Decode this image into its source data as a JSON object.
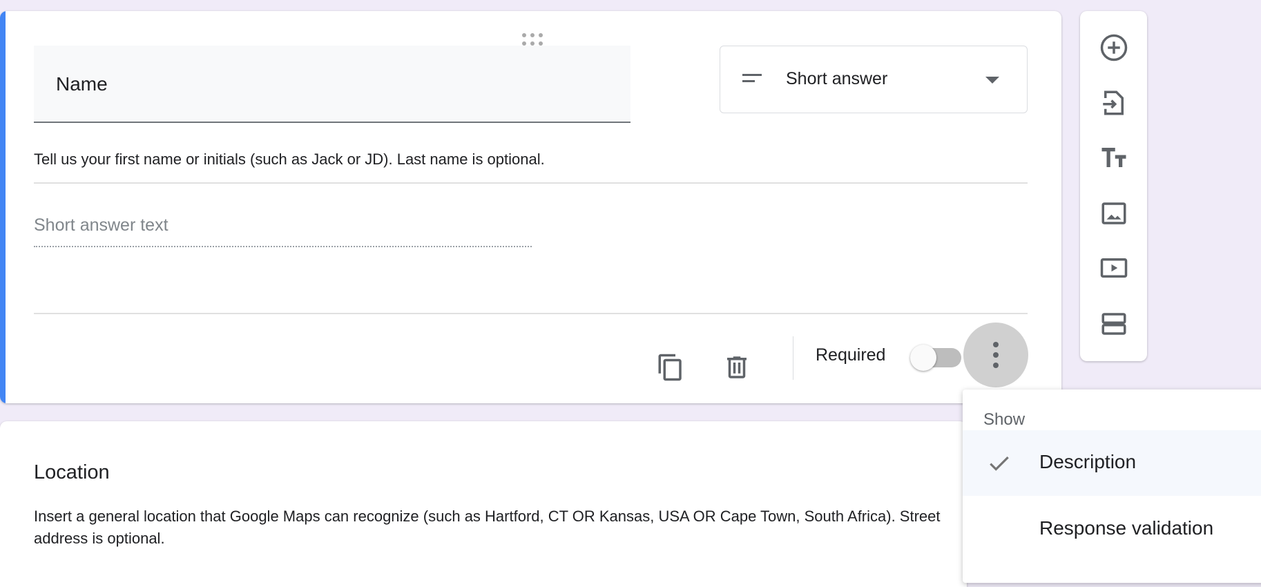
{
  "question": {
    "title": "Name",
    "type_label": "Short answer",
    "description": "Tell us your first name or initials (such as Jack or JD). Last name is optional.",
    "answer_placeholder": "Short answer text",
    "required_label": "Required",
    "required": false,
    "accent_color": "#4285f4"
  },
  "toolbar": [
    "add-question-icon",
    "import-questions-icon",
    "add-title-icon",
    "add-image-icon",
    "add-video-icon",
    "add-section-icon"
  ],
  "next_question": {
    "title": "Location",
    "description": "Insert a general location that Google Maps can recognize (such as Hartford, CT  OR   Kansas, USA  OR  Cape Town, South Africa). Street address is optional."
  },
  "menu": {
    "header": "Show",
    "items": [
      {
        "label": "Description",
        "checked": true
      },
      {
        "label": "Response validation",
        "checked": false
      }
    ]
  }
}
